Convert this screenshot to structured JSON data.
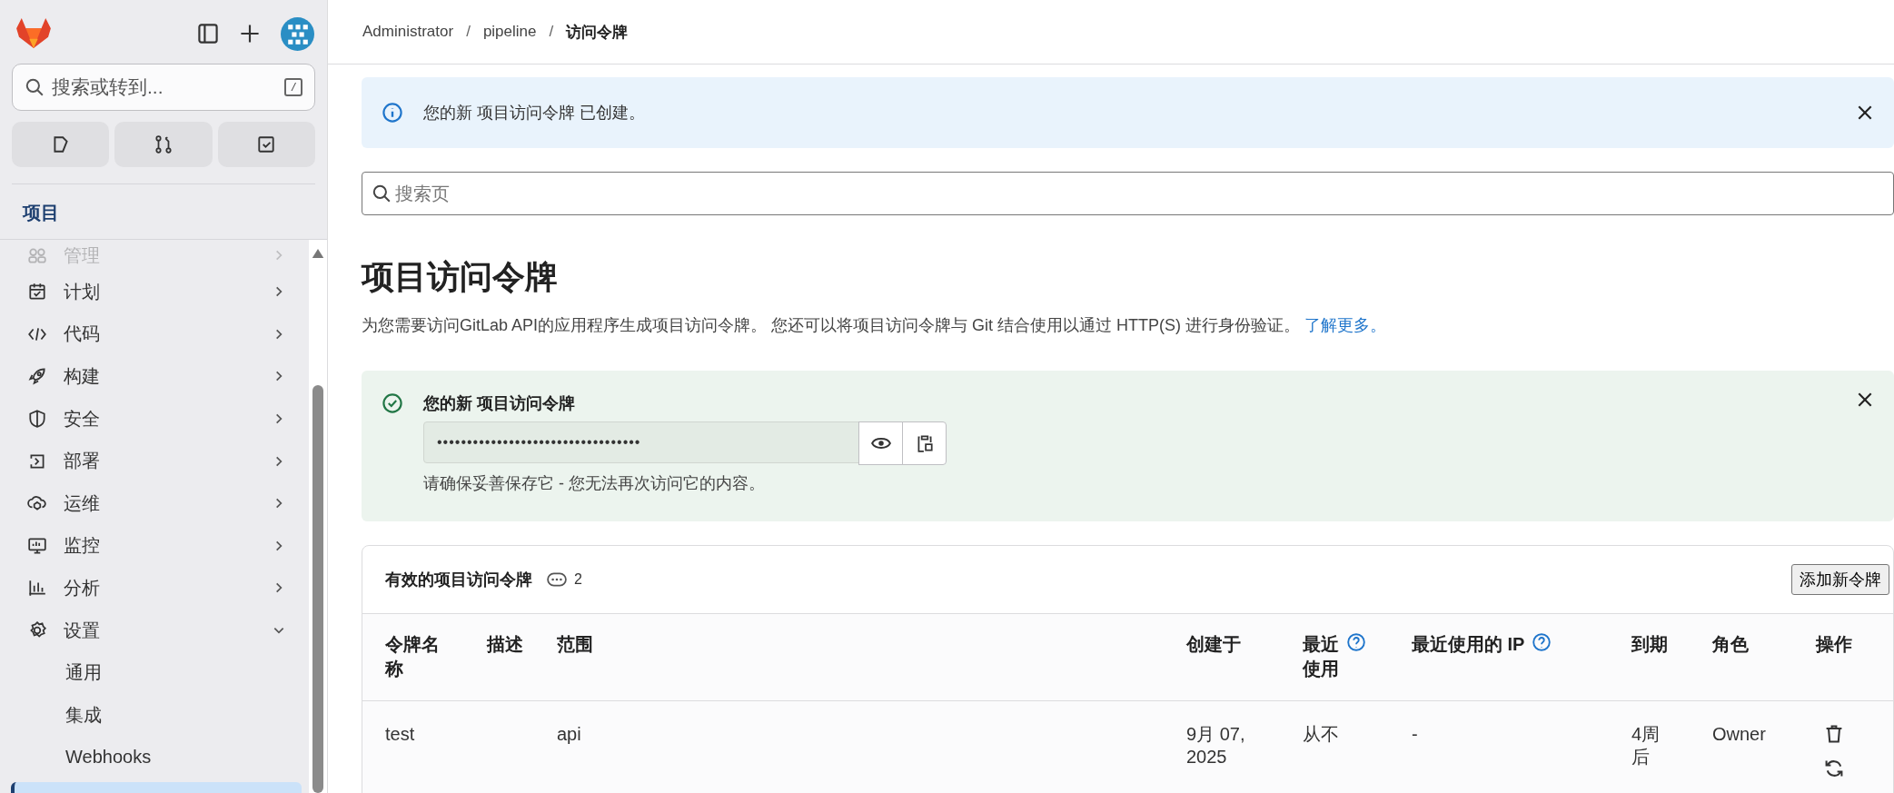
{
  "sidebar": {
    "search": {
      "placeholder": "搜索或转到...",
      "shortcut": "/"
    },
    "section_title": "项目",
    "nav_items": [
      {
        "label": "管理",
        "kind": "group",
        "expanded": false,
        "dimmed": true
      },
      {
        "label": "计划",
        "kind": "group",
        "expanded": false,
        "dimmed": false
      },
      {
        "label": "代码",
        "kind": "group",
        "expanded": false,
        "dimmed": false
      },
      {
        "label": "构建",
        "kind": "group",
        "expanded": false,
        "dimmed": false
      },
      {
        "label": "安全",
        "kind": "group",
        "expanded": false,
        "dimmed": false
      },
      {
        "label": "部署",
        "kind": "group",
        "expanded": false,
        "dimmed": false
      },
      {
        "label": "运维",
        "kind": "group",
        "expanded": false,
        "dimmed": false
      },
      {
        "label": "监控",
        "kind": "group",
        "expanded": false,
        "dimmed": false
      },
      {
        "label": "分析",
        "kind": "group",
        "expanded": false,
        "dimmed": false
      },
      {
        "label": "设置",
        "kind": "group",
        "expanded": true,
        "dimmed": false
      },
      {
        "label": "通用",
        "kind": "sub",
        "selected": false
      },
      {
        "label": "集成",
        "kind": "sub",
        "selected": false
      },
      {
        "label": "Webhooks",
        "kind": "sub",
        "selected": false
      },
      {
        "kind": "sub",
        "selected": true
      }
    ]
  },
  "breadcrumb": {
    "items": [
      "Administrator",
      "pipeline",
      "访问令牌"
    ],
    "separator": "/"
  },
  "info_alert": {
    "message": "您的新 项目访问令牌 已创建。"
  },
  "page_search": {
    "placeholder": "搜索页"
  },
  "title": "项目访问令牌",
  "description": {
    "text": "为您需要访问GitLab API的应用程序生成项目访问令牌。 您还可以将项目访问令牌与 Git 结合使用以通过 HTTP(S) 进行身份验证。",
    "link": "了解更多。"
  },
  "success_alert": {
    "title": "您的新 项目访问令牌",
    "token": "••••••••••••••••••••••••••••••••••",
    "note": "请确保妥善保存它 - 您无法再次访问它的内容。"
  },
  "tokens": {
    "title": "有效的项目访问令牌",
    "count": "2",
    "add_button": "添加新令牌",
    "columns": [
      {
        "label": "令牌名称",
        "help": false
      },
      {
        "label": "描述",
        "help": false
      },
      {
        "label": "范围",
        "help": false
      },
      {
        "label": "创建于",
        "help": false
      },
      {
        "label": "最近使用",
        "help": true
      },
      {
        "label": "最近使用的 IP",
        "help": true
      },
      {
        "label": "到期",
        "help": false
      },
      {
        "label": "角色",
        "help": false
      },
      {
        "label": "操作",
        "help": false
      }
    ],
    "rows": [
      {
        "cells": [
          "test",
          "",
          "api",
          "9月 07, 2025",
          "从不",
          "-",
          "4周后",
          "Owner"
        ]
      }
    ]
  }
}
